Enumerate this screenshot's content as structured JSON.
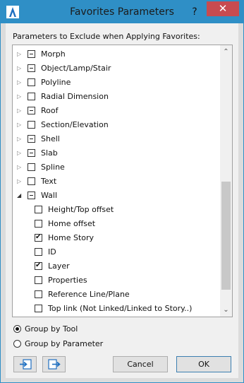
{
  "window": {
    "title": "Favorites Parameters",
    "help_label": "?",
    "close_label": "✕"
  },
  "section_label": "Parameters to Exclude when Applying Favorites:",
  "tree": {
    "items": [
      {
        "label": "Morph",
        "level": 0,
        "expander": "collapsed",
        "state": "partial"
      },
      {
        "label": "Object/Lamp/Stair",
        "level": 0,
        "expander": "collapsed",
        "state": "partial"
      },
      {
        "label": "Polyline",
        "level": 0,
        "expander": "collapsed",
        "state": "unchecked"
      },
      {
        "label": "Radial Dimension",
        "level": 0,
        "expander": "collapsed",
        "state": "unchecked"
      },
      {
        "label": "Roof",
        "level": 0,
        "expander": "collapsed",
        "state": "partial"
      },
      {
        "label": "Section/Elevation",
        "level": 0,
        "expander": "collapsed",
        "state": "unchecked"
      },
      {
        "label": "Shell",
        "level": 0,
        "expander": "collapsed",
        "state": "partial"
      },
      {
        "label": "Slab",
        "level": 0,
        "expander": "collapsed",
        "state": "partial"
      },
      {
        "label": "Spline",
        "level": 0,
        "expander": "collapsed",
        "state": "unchecked"
      },
      {
        "label": "Text",
        "level": 0,
        "expander": "collapsed",
        "state": "unchecked"
      },
      {
        "label": "Wall",
        "level": 0,
        "expander": "expanded",
        "state": "partial"
      },
      {
        "label": "Height/Top offset",
        "level": 1,
        "state": "unchecked"
      },
      {
        "label": "Home offset",
        "level": 1,
        "state": "unchecked"
      },
      {
        "label": "Home Story",
        "level": 1,
        "state": "checked"
      },
      {
        "label": "ID",
        "level": 1,
        "state": "unchecked"
      },
      {
        "label": "Layer",
        "level": 1,
        "state": "checked"
      },
      {
        "label": "Properties",
        "level": 1,
        "state": "unchecked"
      },
      {
        "label": "Reference Line/Plane",
        "level": 1,
        "state": "unchecked"
      },
      {
        "label": "Top link (Not Linked/Linked to Story..)",
        "level": 1,
        "state": "unchecked"
      }
    ]
  },
  "grouping": {
    "options": [
      {
        "label": "Group by Tool",
        "selected": true
      },
      {
        "label": "Group by Parameter",
        "selected": false
      }
    ]
  },
  "buttons": {
    "cancel": "Cancel",
    "ok": "OK"
  },
  "icons": {
    "import": "import-icon",
    "export": "export-icon"
  },
  "colors": {
    "titlebar": "#2f8fc6",
    "close": "#c74b50",
    "icon_blue": "#1e6fc0"
  }
}
